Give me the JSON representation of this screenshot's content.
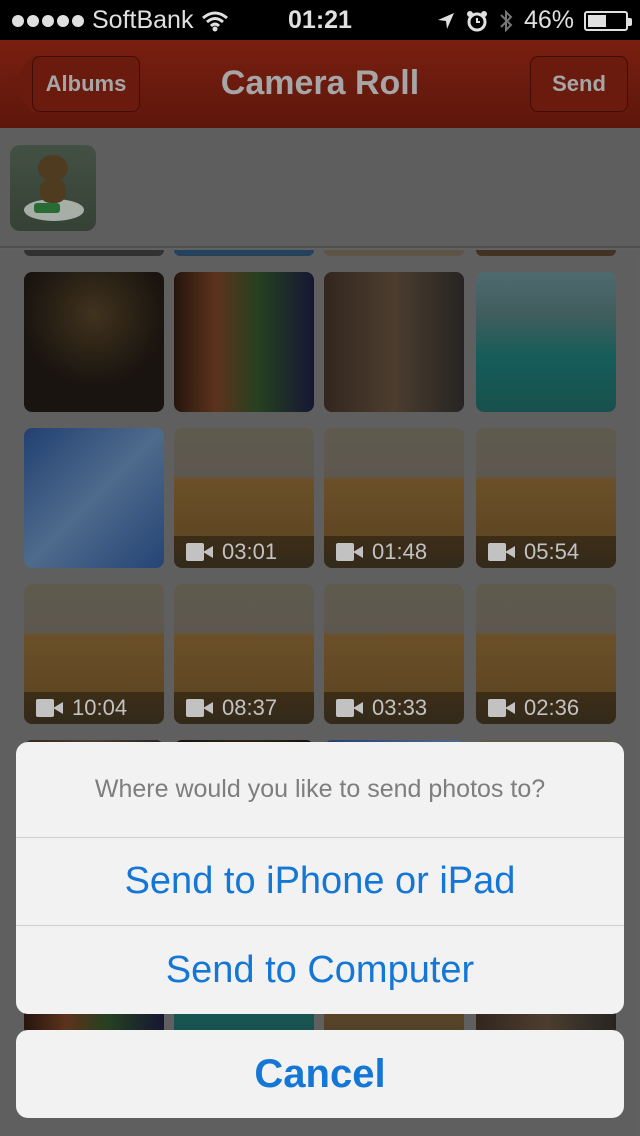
{
  "status_bar": {
    "carrier": "SoftBank",
    "time": "01:21",
    "battery_percent": "46%"
  },
  "nav": {
    "back_label": "Albums",
    "title": "Camera Roll",
    "send_label": "Send"
  },
  "grid": {
    "row2_videos": [
      "03:01",
      "01:48",
      "05:54"
    ],
    "row3_videos": [
      "10:04",
      "08:37",
      "03:33",
      "02:36"
    ]
  },
  "action_sheet": {
    "title": "Where would you like to send photos to?",
    "option_iphone": "Send to iPhone or iPad",
    "option_computer": "Send to Computer",
    "cancel": "Cancel"
  },
  "colors": {
    "accent_blue": "#1477d6",
    "nav_red": "#7a1e10"
  }
}
